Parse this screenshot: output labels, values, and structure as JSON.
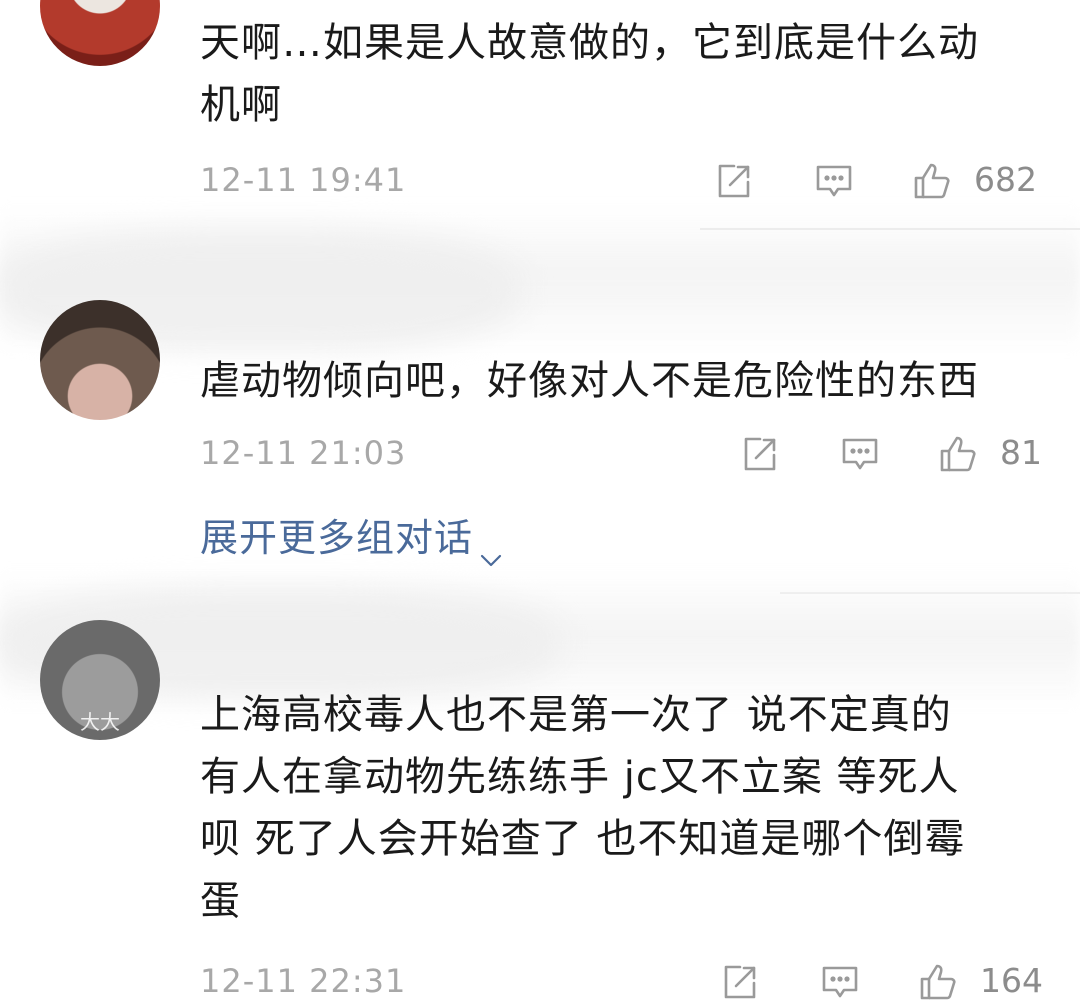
{
  "comments": [
    {
      "text": "天啊…如果是人故意做的，它到底是什么动\n机啊",
      "time": "12-11 19:41",
      "likes": "682",
      "avatar_color": "#c0392b"
    },
    {
      "text": "虐动物倾向吧，好像对人不是危险性的东西",
      "time": "12-11 21:03",
      "likes": "81",
      "avatar_color": "#5a4a3f"
    },
    {
      "text": "上海高校毒人也不是第一次了  说不定真的\n有人在拿动物先练练手 jc又不立案 等死人\n呗 死了人会开始查了 也不知道是哪个倒霉\n蛋",
      "time": "12-11 22:31",
      "likes": "164",
      "avatar_color": "#6f6f6f",
      "avatar_text": "大大"
    }
  ],
  "expand_link": {
    "label": "展开更多组对话",
    "icon": "chevron-down-icon"
  },
  "icons": {
    "share": "share-icon",
    "reply": "comment-icon",
    "like": "thumbs-up-icon"
  },
  "colors": {
    "text": "#1a1a1a",
    "meta": "#a8a8a8",
    "icon": "#9a9a9a",
    "link": "#4a6a9a"
  }
}
